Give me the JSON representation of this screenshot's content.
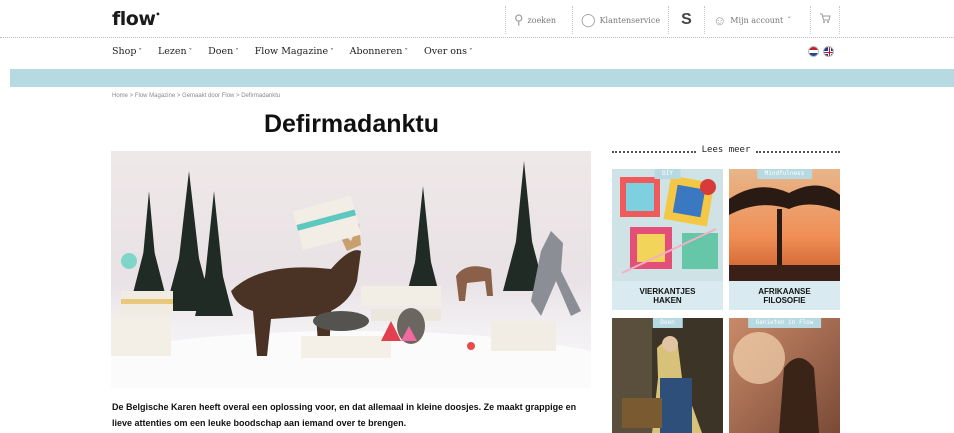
{
  "header": {
    "logo": "flow",
    "search_label": "zoeken",
    "service_label": "Klantenservice",
    "s_label": "S",
    "account_label": "Mijn account"
  },
  "nav": {
    "items": [
      {
        "label": "Shop"
      },
      {
        "label": "Lezen"
      },
      {
        "label": "Doen"
      },
      {
        "label": "Flow Magazine"
      },
      {
        "label": "Abonneren"
      },
      {
        "label": "Over ons"
      }
    ],
    "languages": [
      "nl",
      "en"
    ]
  },
  "breadcrumb": "Home > Flow Magazine > Gemaakt door Flow > Defirmadanktu",
  "article": {
    "title": "Defirmadanktu",
    "intro": "De Belgische Karen heeft overal een oplossing voor, en dat allemaal in kleine doosjes. Ze maakt grappige en lieve attenties om een leuke boodschap aan iemand over te brengen."
  },
  "sidebar": {
    "heading": "Lees meer",
    "cards": [
      {
        "tag": "DIY",
        "caption_line1": "VIERKANTJES",
        "caption_line2": "HAKEN"
      },
      {
        "tag": "Mindfulness",
        "caption_line1": "AFRIKAANSE",
        "caption_line2": "FILOSOFIE"
      },
      {
        "tag": "Doen",
        "caption_line1": "",
        "caption_line2": ""
      },
      {
        "tag": "Genieten in Flow",
        "caption_line1": "",
        "caption_line2": ""
      }
    ]
  },
  "colors": {
    "accent_band": "#b7d9e1",
    "caption_bg": "#d9ebf0"
  }
}
